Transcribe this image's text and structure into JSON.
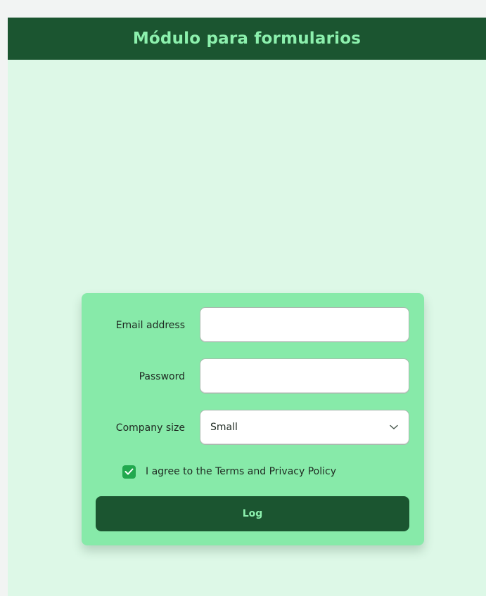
{
  "header": {
    "title": "Módulo para formularios"
  },
  "form": {
    "email": {
      "label": "Email address",
      "value": ""
    },
    "password": {
      "label": "Password",
      "value": ""
    },
    "company_size": {
      "label": "Company size",
      "selected": "Small"
    },
    "agree": {
      "label": "I agree to the Terms and Privacy Policy",
      "checked": true
    },
    "submit_label": "Log"
  },
  "colors": {
    "page_background": "#ddf8e7",
    "header_background": "#1b5530",
    "accent_text": "#8cf0ad",
    "card_background": "#87eaa9",
    "checkbox": "#21a84e"
  },
  "icons": {
    "select_chevron": "chevron-down-icon",
    "checkbox_mark": "checkmark-icon"
  }
}
